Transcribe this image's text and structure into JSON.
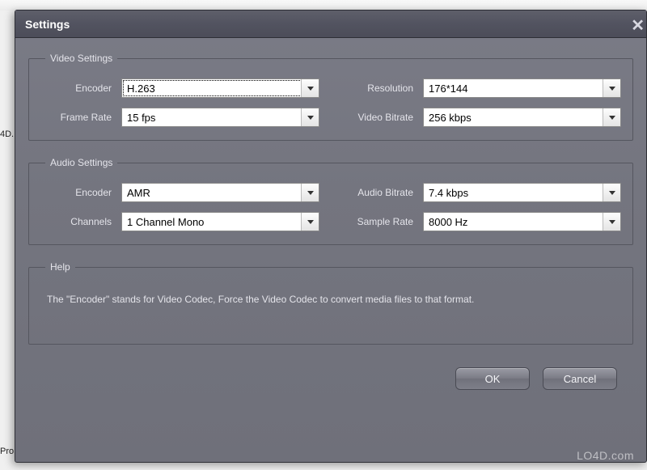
{
  "window": {
    "title": "Settings"
  },
  "video": {
    "legend": "Video Settings",
    "encoder_label": "Encoder",
    "encoder_value": "H.263",
    "resolution_label": "Resolution",
    "resolution_value": "176*144",
    "framerate_label": "Frame Rate",
    "framerate_value": "15 fps",
    "vbitrate_label": "Video Bitrate",
    "vbitrate_value": "256 kbps"
  },
  "audio": {
    "legend": "Audio Settings",
    "encoder_label": "Encoder",
    "encoder_value": "AMR",
    "abitrate_label": "Audio Bitrate",
    "abitrate_value": "7.4 kbps",
    "channels_label": "Channels",
    "channels_value": "1 Channel Mono",
    "samplerate_label": "Sample Rate",
    "samplerate_value": "8000 Hz"
  },
  "help": {
    "legend": "Help",
    "text": "The \"Encoder\" stands for Video Codec, Force the Video Codec to convert media files to that format."
  },
  "buttons": {
    "ok": "OK",
    "cancel": "Cancel"
  },
  "watermark": "LO4D.com",
  "side": {
    "frag1": "4D.",
    "frag2": "Pro"
  }
}
